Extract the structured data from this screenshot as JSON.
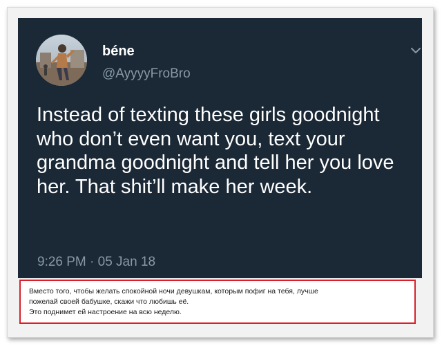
{
  "tweet": {
    "display_name": "béne",
    "handle": "@AyyyyFroBro",
    "text": "Instead of texting these girls goodnight who don’t even want you, text your grandma goodnight and tell her you love her. That shit’ll make her week.",
    "timestamp": "9:26 PM · 05 Jan 18",
    "menu_icon": "chevron-down-icon",
    "background_color": "#1b2836"
  },
  "translation": {
    "lines": [
      "Вместо того, чтобы желать спокойной ночи девушкам, которым пофиг на тебя, лучше",
      "пожелай своей бабушке, скажи что любишь её.",
      "Это поднимет ей настроение на всю неделю."
    ],
    "border_color": "#d9202a"
  }
}
